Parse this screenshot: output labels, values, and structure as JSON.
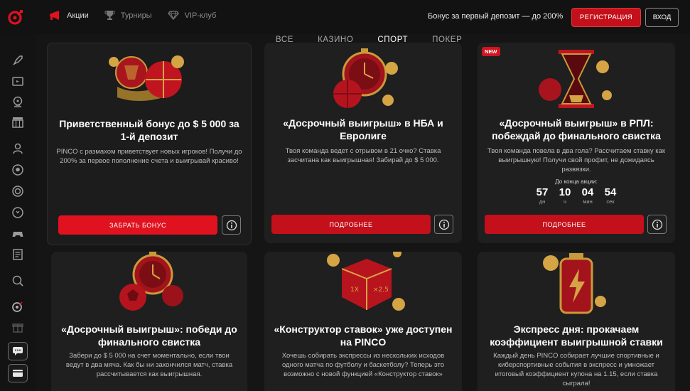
{
  "header": {
    "nav": [
      {
        "label": "Акции",
        "icon": "megaphone-icon"
      },
      {
        "label": "Турниры",
        "icon": "trophy-icon"
      },
      {
        "label": "VIP-клуб",
        "icon": "diamond-icon"
      }
    ],
    "promo_text": "Бонус за первый депозит — до 200%",
    "register_label": "РЕГИСТРАЦИЯ",
    "login_label": "ВХОД",
    "accent_color": "#c4101a"
  },
  "tabs": [
    "ВСЕ",
    "КАЗИНО",
    "СПОРТ",
    "ПОКЕР"
  ],
  "active_tab": "СПОРТ",
  "sidebar": [
    "rocket-icon",
    "tv-icon",
    "roulette-icon",
    "slot-machine-icon",
    "dealer-icon",
    "soccer-icon",
    "target-icon",
    "stopwatch-icon",
    "gamepad-icon",
    "newspaper-icon",
    "magnifier-icon",
    "dart-icon",
    "gift-icon",
    "chat-icon",
    "card-icon"
  ],
  "cards": [
    {
      "title": "Приветственный бонус до $ 5 000 за 1-й депозит",
      "desc": "PINCO с размахом приветствует новых игроков! Получи до 200% за первое пополнение счета и выигрывай красиво!",
      "button": "ЗАБРАТЬ БОНУС",
      "art": "balls-trophy-art"
    },
    {
      "title": "«Досрочный выигрыш» в НБА и Евролиге",
      "desc": "Твоя команда ведет с отрывом в 21 очко? Ставка засчитана как выигрышная! Забирай до $ 5 000.",
      "button": "ПОДРОБНЕЕ",
      "art": "stopwatch-basketball-art"
    },
    {
      "badge": "NEW",
      "title": "«Досрочный выигрыш» в РПЛ: побеждай до финального свистка",
      "desc": "Твоя команда повела в два гола? Рассчитаем ставку как выигрышную! Получи свой профит, не дожидаясь развязки.",
      "countdown_label": "До конца акции:",
      "countdown": [
        {
          "value": "57",
          "unit": "дн"
        },
        {
          "value": "10",
          "unit": "ч"
        },
        {
          "value": "04",
          "unit": "мин"
        },
        {
          "value": "54",
          "unit": "сек"
        }
      ],
      "button": "ПОДРОБНЕЕ",
      "art": "hourglass-art"
    },
    {
      "title": "«Досрочный выигрыш»: победи до финального свистка",
      "desc": "Забери до $ 5 000 на счет моментально, если твои ведут в два мяча. Как бы ни закончился матч, ставка рассчитывается как выигрышная.",
      "art": "stopwatch-football-art"
    },
    {
      "title": "«Конструктор ставок» уже доступен на PINCO",
      "desc": "Хочешь собирать экспрессы из нескольких исходов одного матча по футболу и баскетболу? Теперь это возможно с новой функцией «Конструктор ставок»",
      "art": "puzzle-cube-art"
    },
    {
      "title": "Экспресс дня: прокачаем коэффициент выигрышной ставки",
      "desc": "Каждый день PINCO собирает лучшие спортивные и киберспортивные события в экспресс и умножает итоговый коэффициент купона на 1.15, если ставка сыграла!",
      "art": "battery-art"
    }
  ]
}
